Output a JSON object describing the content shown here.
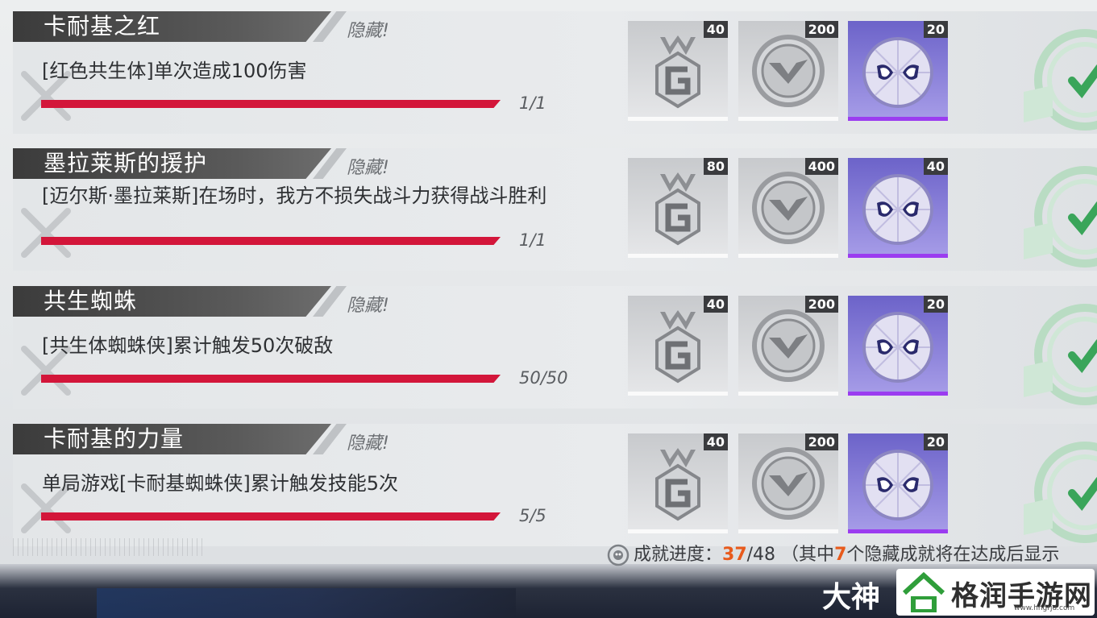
{
  "achievements": [
    {
      "title": "卡耐基之红",
      "tag": "隐藏!",
      "description": "[红色共生体]单次造成100伤害",
      "progress_text": "1/1",
      "progress_fraction": 1.0,
      "rewards": [
        {
          "icon": "g-medal-icon",
          "count": "40"
        },
        {
          "icon": "shield-coin-icon",
          "count": "200"
        },
        {
          "icon": "spider-mask-icon",
          "count": "20"
        }
      ]
    },
    {
      "title": "墨拉莱斯的援护",
      "tag": "隐藏!",
      "description": "[迈尔斯·墨拉莱斯]在场时，我方不损失战斗力获得战斗胜利",
      "progress_text": "1/1",
      "progress_fraction": 1.0,
      "rewards": [
        {
          "icon": "g-medal-icon",
          "count": "80"
        },
        {
          "icon": "shield-coin-icon",
          "count": "400"
        },
        {
          "icon": "spider-mask-icon",
          "count": "40"
        }
      ]
    },
    {
      "title": "共生蜘蛛",
      "tag": "隐藏!",
      "description": "[共生体蜘蛛侠]累计触发50次破敌",
      "progress_text": "50/50",
      "progress_fraction": 1.0,
      "rewards": [
        {
          "icon": "g-medal-icon",
          "count": "40"
        },
        {
          "icon": "shield-coin-icon",
          "count": "200"
        },
        {
          "icon": "spider-mask-icon",
          "count": "20"
        }
      ]
    },
    {
      "title": "卡耐基的力量",
      "tag": "隐藏!",
      "description": "单局游戏[卡耐基蜘蛛侠]累计触发技能5次",
      "progress_text": "5/5",
      "progress_fraction": 1.0,
      "rewards": [
        {
          "icon": "g-medal-icon",
          "count": "40"
        },
        {
          "icon": "shield-coin-icon",
          "count": "200"
        },
        {
          "icon": "spider-mask-icon",
          "count": "20"
        }
      ]
    }
  ],
  "footer": {
    "label": "成就进度：",
    "done": "37",
    "total": "/48",
    "note_pre": "（其中",
    "note_num": "7",
    "note_post": "个隐藏成就将在达成后显示"
  },
  "watermark": {
    "left": "大神",
    "site": "格润手游网",
    "url": "www.hngrjd.com"
  },
  "colors": {
    "progress_bar": "#d3163a",
    "accent_orange": "#e85a1c",
    "check_green": "#3aa55a",
    "purple_highlight": "#9b3cf0"
  }
}
